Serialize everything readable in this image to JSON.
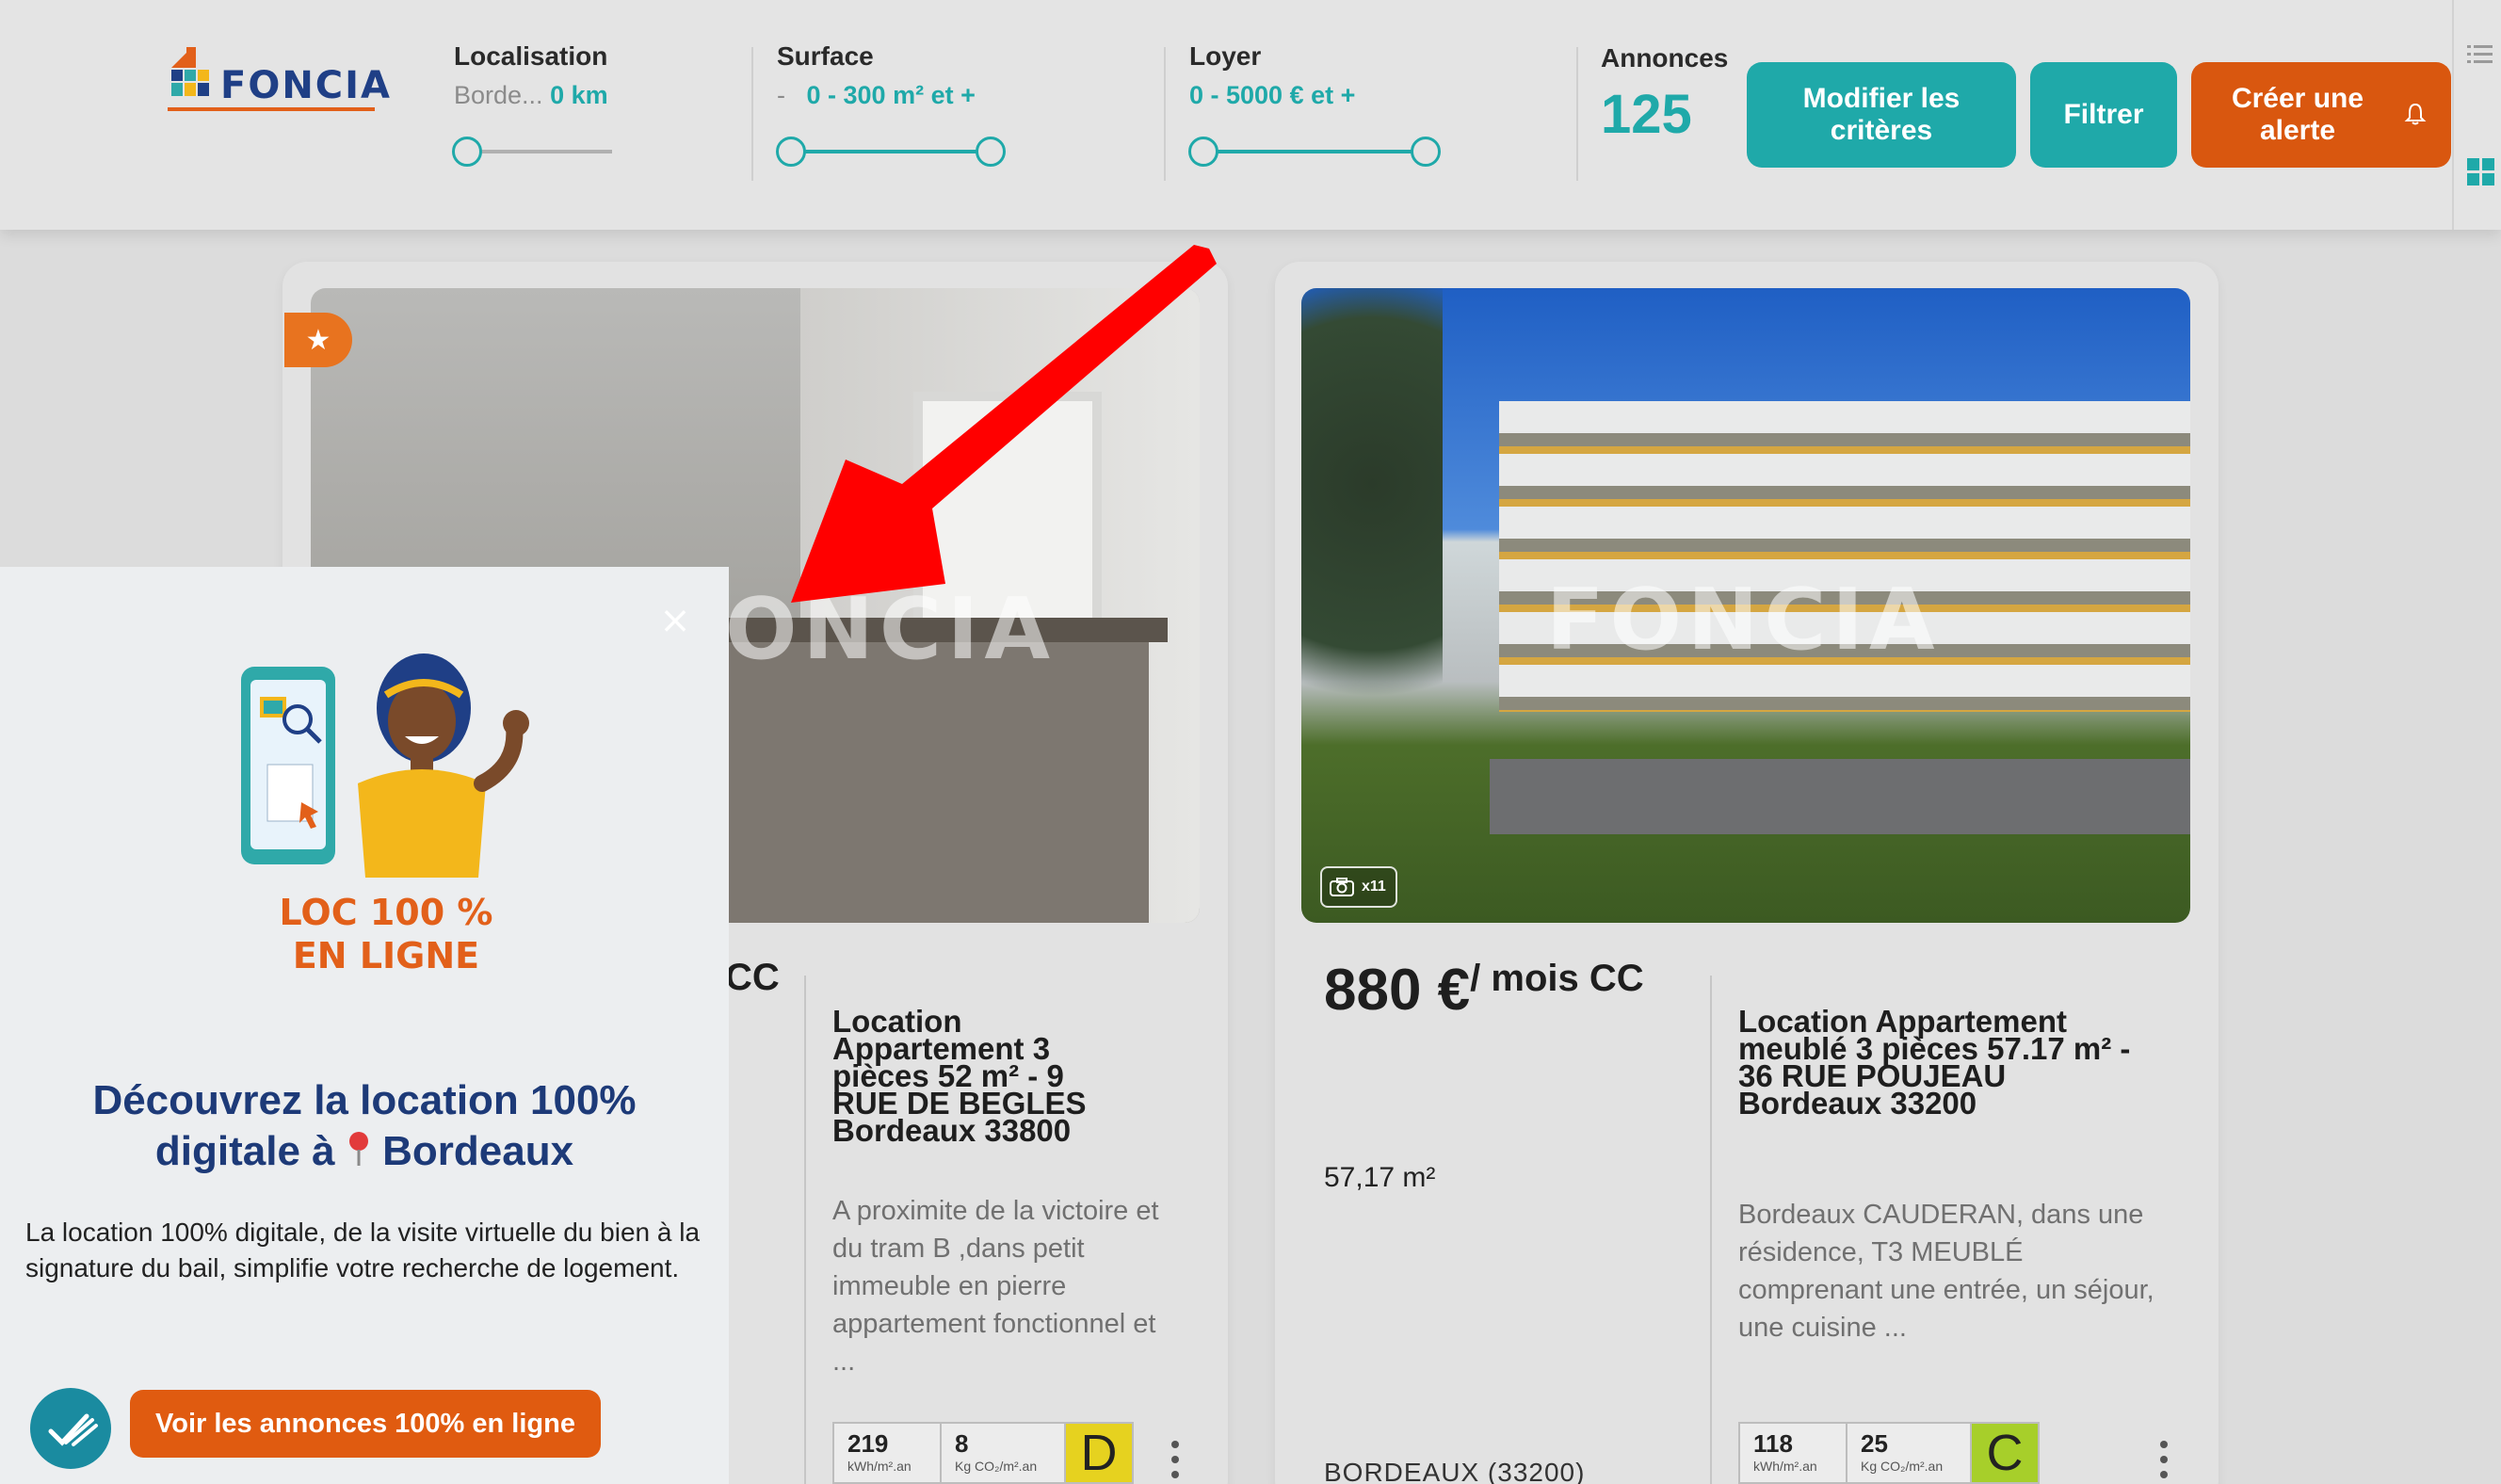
{
  "brand": {
    "logo_text": "FONCIA"
  },
  "criteria": {
    "localisation": {
      "label": "Localisation",
      "city": "Borde...",
      "radius": "0 km"
    },
    "surface": {
      "label": "Surface",
      "prefix": "-",
      "range": "0 - 300 m² et +"
    },
    "loyer": {
      "label": "Loyer",
      "range": "0 - 5000 € et +"
    },
    "annonces": {
      "label": "Annonces",
      "count": "125"
    }
  },
  "buttons": {
    "modify": "Modifier les critères",
    "filter": "Filtrer",
    "alert": "Créer une alerte"
  },
  "listings": [
    {
      "price_suffix": "CC",
      "title": "Location Appartement 3 pièces 52 m² - 9 RUE DE BEGLES Bordeaux 33800",
      "description": "A proximite de la victoire et du tram B ,dans petit immeuble en pierre appartement fonctionnel et ...",
      "energy": {
        "kwh": "219",
        "kwh_unit": "kWh/m².an",
        "co2": "8",
        "co2_unit": "Kg CO₂/m².an",
        "grade": "D",
        "grade_color": "#e6d21f"
      },
      "watermark": "ONCIA"
    },
    {
      "price": "880 €",
      "price_suffix": "/ mois CC",
      "surface": "57,17 m²",
      "title": "Location Appartement meublé 3 pièces 57.17 m² - 36 RUE POUJEAU Bordeaux 33200",
      "description": "Bordeaux CAUDERAN, dans une résidence, T3 MEUBLÉ comprenant une entrée, un séjour, une cuisine ...",
      "city": "BORDEAUX (33200)",
      "photo_count": "x11",
      "energy": {
        "kwh": "118",
        "kwh_unit": "kWh/m².an",
        "co2": "25",
        "co2_unit": "Kg CO₂/m².an",
        "grade": "C",
        "grade_color": "#a7cf2a"
      },
      "watermark": "FONCIA"
    }
  ],
  "popup": {
    "illustration_text": "LOC 100 % EN LIGNE",
    "heading_line1": "Découvrez la location 100%",
    "heading_line2": "digitale à",
    "heading_city": "Bordeaux",
    "body": "La location 100% digitale, de la visite virtuelle du bien à la signature du bail, simplifie votre recherche de logement.",
    "cta": "Voir les annonces 100% en ligne",
    "close": "×"
  },
  "colors": {
    "teal": "#1fa9a9",
    "orange": "#d9570f",
    "navy": "#1d3a78",
    "annotation_arrow": "#ff0000"
  }
}
